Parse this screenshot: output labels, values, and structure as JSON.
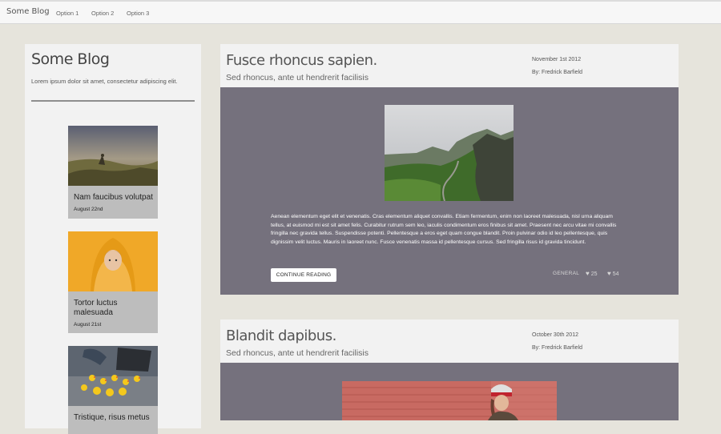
{
  "navbar": {
    "brand": "Some Blog",
    "items": [
      "Option 1",
      "Option 2",
      "Option 3"
    ]
  },
  "sidebar": {
    "title": "Some Blog",
    "description": "Lorem ipsum dolor sit amet, consectetur adipiscing elit.",
    "cards": [
      {
        "title": "Nam faucibus volutpat",
        "date": "August 22nd"
      },
      {
        "title": "Tortor luctus malesuada",
        "date": "August 21st"
      },
      {
        "title": "Tristique, risus metus",
        "date": ""
      }
    ]
  },
  "posts": [
    {
      "title": "Fusce rhoncus sapien.",
      "subtitle": "Sed rhoncus, ante ut hendrerit facilisis",
      "date": "November 1st 2012",
      "author": "By: Fredrick Barfield",
      "text": "Aenean elementum eget elit et venenatis. Cras elementum aliquet convallis. Etiam fermentum, enim non laoreet malesuada, nisl urna aliquam tellus, at euismod mi est sit amet felis. Curabitur rutrum sem leo, iaculis condimentum eros finibus sit amet. Praesent nec arcu vitae mi convallis fringilla nec gravida tellus. Suspendisse potenti. Pellentesque a eros eget quam congue blandit. Proin pulvinar odio id leo pellentesque, quis dignissim velit luctus. Mauris in laoreet nunc. Fusce venenatis massa id pellentesque cursus. Sed fringilla risus id gravida tincidunt.",
      "continue_label": "CONTINUE READING",
      "category": "GENERAL",
      "likes": "25",
      "favorites": "54"
    },
    {
      "title": "Blandit dapibus.",
      "subtitle": "Sed rhoncus, ante ut hendrerit facilisis",
      "date": "October 30th 2012",
      "author": "By: Fredrick Barfield"
    }
  ],
  "colors": {
    "page_bg": "#e6e4dc",
    "panel_bg": "#f2f2f2",
    "post_body_bg": "#75717d",
    "card_bg": "#bdbdbd"
  }
}
